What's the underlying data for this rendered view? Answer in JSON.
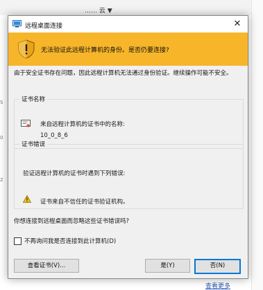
{
  "background": {
    "top_text": "…… 云 ▼",
    "left_marks": [
      "S",
      "0",
      "2"
    ],
    "bottom_link": "查看更多"
  },
  "dialog": {
    "title": "远程桌面连接",
    "close_label": "✕",
    "banner_text": "无法验证此远程计算机的身份。是否仍要连接?",
    "intro": "由于安全证书存在问题，因此远程计算机无法通过身份验证。继续操作可能不安全。",
    "cert_group": {
      "legend": "证书名称",
      "line1": "来自远程计算机的证书中的名称:",
      "name": "10_0_8_6"
    },
    "error_group": {
      "legend": "证书错误",
      "line1": "验证远程计算机的证书时遇到下列错误:",
      "error": "证书来自不信任的证书验证机构。"
    },
    "question": "你想连接到远程桌面而忽略这些证书错误吗?",
    "checkbox_label": "不再询问我是否连接到此计算机(D)",
    "checkbox_checked": false,
    "buttons": {
      "view_cert": "查看证书(V)...",
      "yes": "是(Y)",
      "no": "否(N)"
    },
    "colors": {
      "banner": "#f7b529",
      "default_button_border": "#0078d7"
    }
  }
}
